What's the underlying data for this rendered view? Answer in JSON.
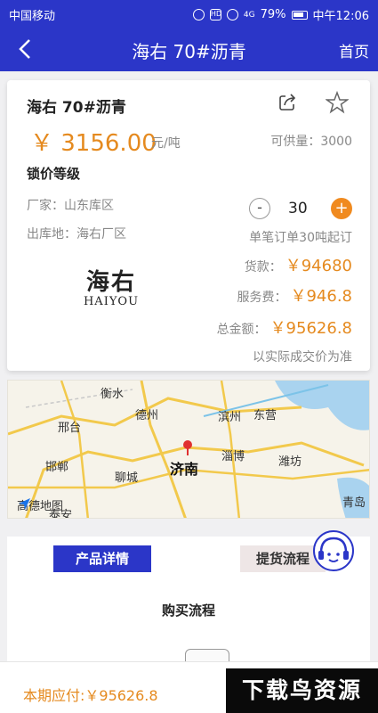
{
  "status": {
    "carrier": "中国移动",
    "hd": "HD",
    "signal": "4G",
    "battery": "79%",
    "time": "中午12:06"
  },
  "nav": {
    "title": "海右 70#沥青",
    "home": "首页"
  },
  "product": {
    "name": "海右 70#沥青",
    "price": "￥ 3156.00",
    "price_unit": "元/吨",
    "supply": "可供量：3000",
    "grade": "锁价等级",
    "factory": "厂家：山东库区",
    "depot": "出库地：海右厂区",
    "quantity": "30",
    "minus": "-",
    "plus": "+",
    "min_order": "单笔订单30吨起订",
    "logo_cn": "海右",
    "logo_en": "HAIYOU",
    "goods_label": "货款：",
    "goods_value": "￥94680",
    "fee_label": "服务费：",
    "fee_value": "￥946.8",
    "total_label": "总金额：",
    "total_value": "￥95626.8",
    "note": "以实际成交价为准",
    "accent_color": "#e58a1f"
  },
  "map": {
    "cities": [
      "衡水",
      "德州",
      "滨州",
      "东营",
      "邢台",
      "济南",
      "淄博",
      "潍坊",
      "邯郸",
      "聊城",
      "青岛",
      "泰安"
    ],
    "provider": "高德地图"
  },
  "detail": {
    "tab_product": "产品详情",
    "tab_delivery": "提货流程",
    "flow_title": "购买流程"
  },
  "bottom": {
    "due": "本期应付:￥95626.8"
  },
  "watermark": "下载鸟资源",
  "colors": {
    "primary": "#2b36c8",
    "accent": "#e58a1f"
  }
}
